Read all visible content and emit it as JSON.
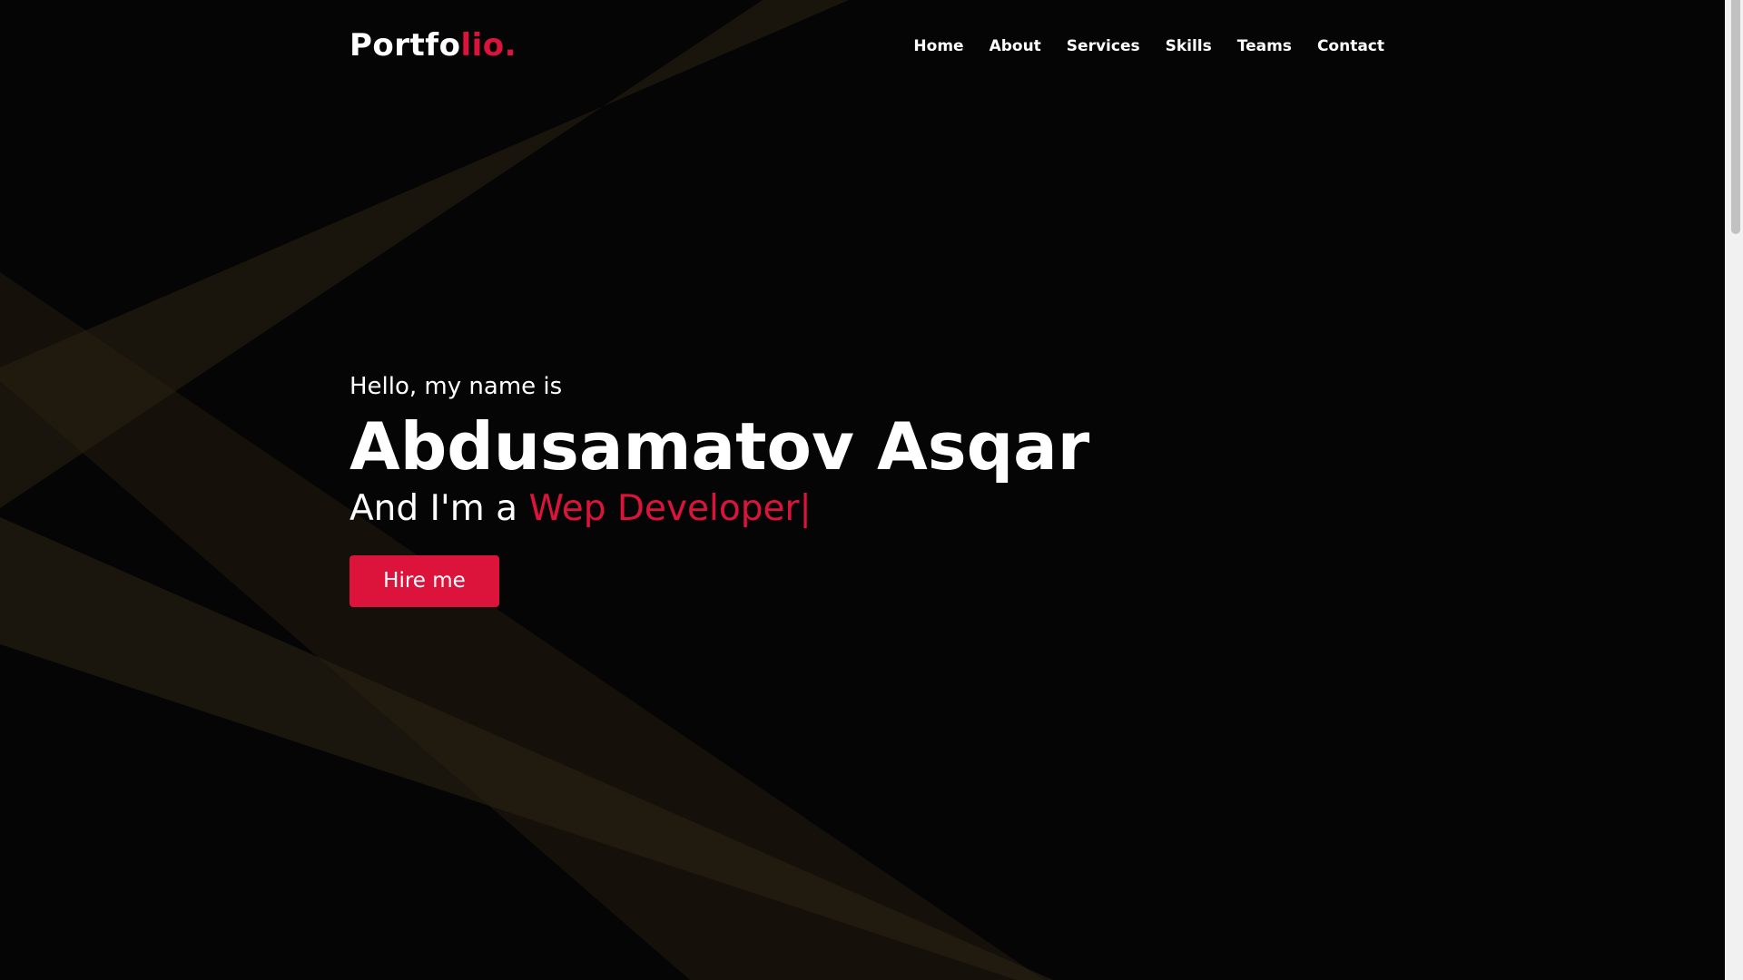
{
  "logo": {
    "main": "Portfo",
    "accent": "lio."
  },
  "nav": {
    "items": [
      {
        "label": "Home"
      },
      {
        "label": "About"
      },
      {
        "label": "Services"
      },
      {
        "label": "Skills"
      },
      {
        "label": "Teams"
      },
      {
        "label": "Contact"
      }
    ]
  },
  "hero": {
    "greeting": "Hello, my name is",
    "name": "Abdusamatov Asqar",
    "role_prefix": "And I'm a ",
    "role": "Wep Developer|",
    "cta_label": "Hire me"
  },
  "colors": {
    "background": "#050505",
    "accent": "#dc143c",
    "text": "#ffffff",
    "beam": "#2a2212"
  }
}
